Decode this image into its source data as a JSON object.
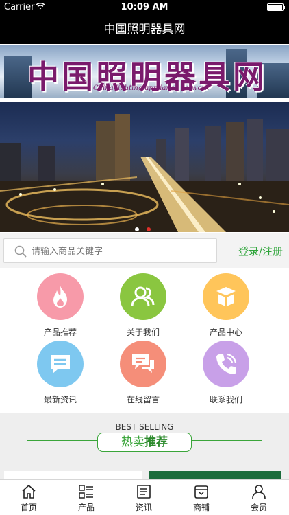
{
  "status_bar": {
    "carrier": "Carrier",
    "time": "10:09 AM"
  },
  "nav": {
    "title": "中国照明器具网"
  },
  "logo_banner": {
    "logo_text": "中国照明器具网",
    "logo_sub": "China lighting appliance network"
  },
  "hero": {
    "slide_count": 2,
    "active_slide": 2
  },
  "search": {
    "placeholder": "请输入商品关键字",
    "login_label": "登录/注册"
  },
  "grid": {
    "items": [
      {
        "label": "产品推荐",
        "icon": "flame-icon",
        "color": "#f79aa9"
      },
      {
        "label": "关于我们",
        "icon": "users-icon",
        "color": "#8ac640"
      },
      {
        "label": "产品中心",
        "icon": "box-icon",
        "color": "#ffc55a"
      },
      {
        "label": "最新资讯",
        "icon": "message-icon",
        "color": "#7ec8f0"
      },
      {
        "label": "在线留言",
        "icon": "chat-icon",
        "color": "#f58e79"
      },
      {
        "label": "联系我们",
        "icon": "phone-icon",
        "color": "#c8a0e8"
      }
    ]
  },
  "best_selling": {
    "eng": "BEST SELLING",
    "cn_a": "热卖",
    "cn_b": "推荐"
  },
  "tab_bar": {
    "items": [
      {
        "label": "首页",
        "icon": "home-icon"
      },
      {
        "label": "产品",
        "icon": "grid-list-icon"
      },
      {
        "label": "资讯",
        "icon": "news-icon"
      },
      {
        "label": "商铺",
        "icon": "shop-icon"
      },
      {
        "label": "会员",
        "icon": "user-icon"
      }
    ]
  },
  "colors": {
    "accent_green": "#3aa53a",
    "dot_active": "#e0302a",
    "dot_inactive": "#ffffff"
  }
}
